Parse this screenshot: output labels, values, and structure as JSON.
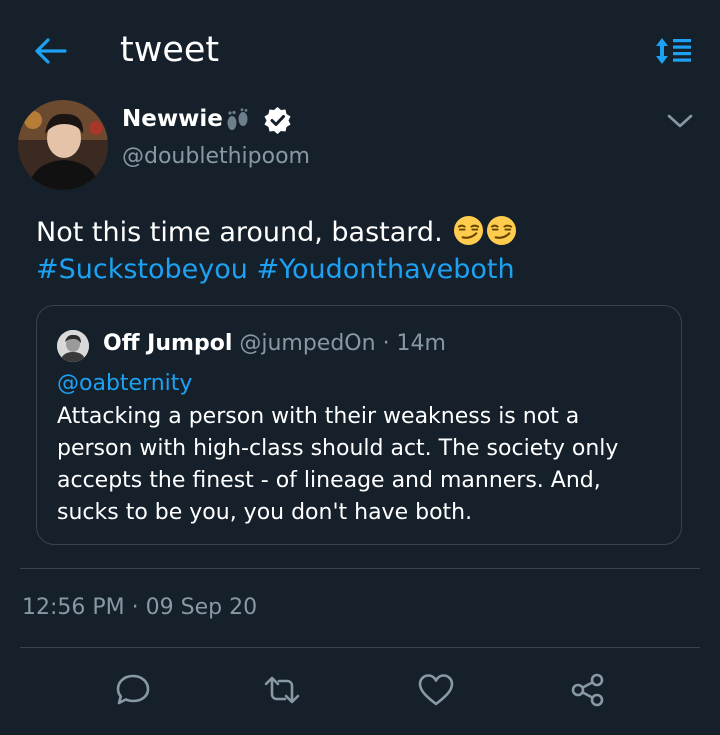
{
  "header": {
    "title": "tweet",
    "back_icon": "arrow-left-icon",
    "sort_icon": "sort-list-icon"
  },
  "tweet": {
    "author_name": "Newwie",
    "author_handle": "@doublethipoom",
    "verified": true,
    "name_emoji": "footprints",
    "text": "Not this time around, bastard.",
    "text_emojis": [
      "smirking-face",
      "smirking-face"
    ],
    "hashtags": [
      "#Sucksto﻿beyou",
      "#Youdonthaveboth"
    ],
    "timestamp": "12:56 PM · 09 Sep 20"
  },
  "quoted_tweet": {
    "author_name": "Off Jumpol",
    "author_handle": "@jumpedOn",
    "age": "14m",
    "meta": "@jumpedOn · 14m",
    "mention": "@oabternity",
    "body_lines": [
      "Attacking a person with their weakness is not a",
      "person with high-class should act. The society only",
      "accepts the finest - of lineage and manners. And,",
      "sucks to be you, you don't have both."
    ]
  },
  "actions": [
    {
      "name": "reply",
      "icon": "comment-icon"
    },
    {
      "name": "retweet",
      "icon": "retweet-icon"
    },
    {
      "name": "like",
      "icon": "heart-icon"
    },
    {
      "name": "share",
      "icon": "share-icon"
    }
  ],
  "colors": {
    "background": "#15202b",
    "accent": "#1da1f2",
    "secondary_text": "#8899a6",
    "border": "#38444d"
  }
}
